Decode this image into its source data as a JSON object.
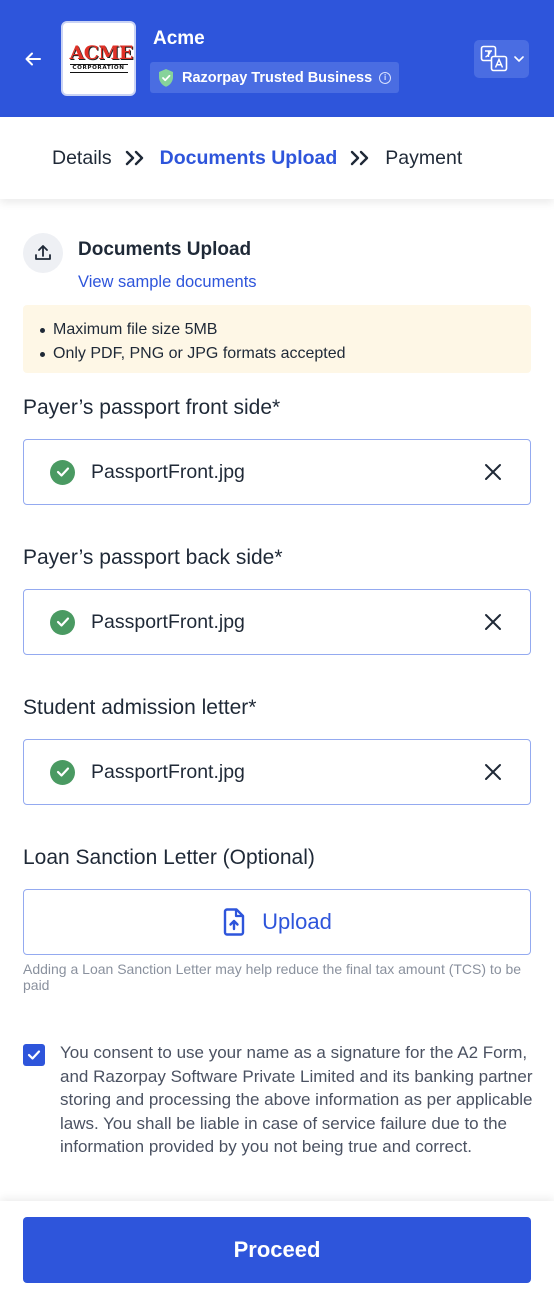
{
  "header": {
    "merchant_name": "Acme",
    "logo_text": "ACME",
    "logo_subtext": "CORPORATION",
    "trust_badge": "Razorpay Trusted Business",
    "info_icon_glyph": "i",
    "brand_color": "#2e55db"
  },
  "stepper": {
    "steps": [
      "Details",
      "Documents Upload",
      "Payment"
    ],
    "active_index": 1
  },
  "section": {
    "title": "Documents Upload",
    "sample_link": "View sample documents",
    "notes": [
      "Maximum file size 5MB",
      "Only PDF, PNG or JPG formats accepted"
    ]
  },
  "fields": [
    {
      "label": "Payer’s passport front side*",
      "file_name": "PassportFront.jpg",
      "status": "uploaded"
    },
    {
      "label": "Payer’s passport back side*",
      "file_name": "PassportFront.jpg",
      "status": "uploaded"
    },
    {
      "label": "Student admission letter*",
      "file_name": "PassportFront.jpg",
      "status": "uploaded"
    }
  ],
  "optional_field": {
    "label": "Loan Sanction Letter (Optional)",
    "button_label": "Upload",
    "hint": "Adding a Loan Sanction Letter may help reduce the final tax amount (TCS) to be paid"
  },
  "consent": {
    "checked": true,
    "text": "You consent to use your name as a signature for the A2 Form, and Razorpay Software Private Limited and its banking partner storing and processing the above information as per applicable laws. You shall be liable in case of service failure due to the information provided by you not being true and correct."
  },
  "footer": {
    "proceed_label": "Proceed"
  }
}
